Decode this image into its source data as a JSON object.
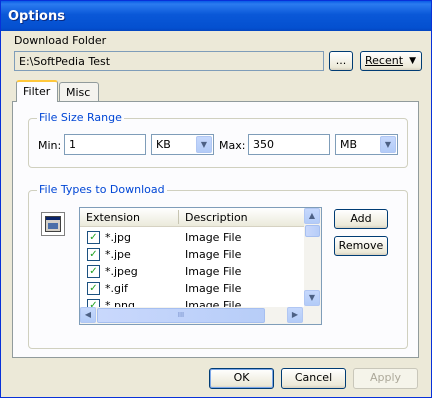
{
  "window": {
    "title": "Options"
  },
  "download_folder": {
    "label": "Download Folder",
    "path": "E:\\SoftPedia Test",
    "browse_label": "...",
    "recent_label": "Recent"
  },
  "tabs": [
    {
      "label": "Filter",
      "active": true
    },
    {
      "label": "Misc",
      "active": false
    }
  ],
  "file_size": {
    "group_title": "File Size Range",
    "min_label": "Min:",
    "min_value": "1",
    "min_unit": "KB",
    "max_label": "Max:",
    "max_value": "350",
    "max_unit": "MB"
  },
  "file_types": {
    "group_title": "File Types to Download",
    "columns": [
      "Extension",
      "Description"
    ],
    "rows": [
      {
        "ext": "*.jpg",
        "desc": "Image File",
        "checked": true
      },
      {
        "ext": "*.jpe",
        "desc": "Image File",
        "checked": true
      },
      {
        "ext": "*.jpeg",
        "desc": "Image File",
        "checked": true
      },
      {
        "ext": "*.gif",
        "desc": "Image File",
        "checked": true
      },
      {
        "ext": "*.png",
        "desc": "Image File",
        "checked": true
      }
    ],
    "add_label": "Add",
    "remove_label": "Remove",
    "hscroll_grip": "III"
  },
  "footer": {
    "ok_label": "OK",
    "cancel_label": "Cancel",
    "apply_label": "Apply"
  }
}
